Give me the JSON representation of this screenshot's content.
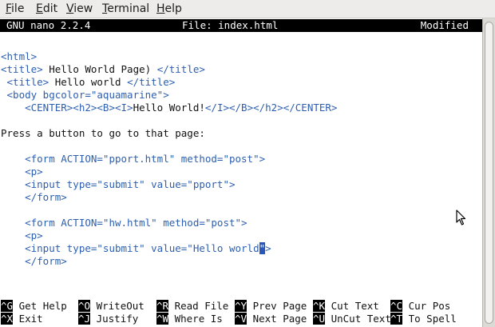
{
  "menubar": {
    "items": [
      {
        "accel": "F",
        "rest": "ile"
      },
      {
        "accel": "E",
        "rest": "dit"
      },
      {
        "accel": "V",
        "rest": "iew"
      },
      {
        "accel": "T",
        "rest": "erminal"
      },
      {
        "accel": "H",
        "rest": "elp"
      }
    ]
  },
  "nano": {
    "version": "GNU nano 2.2.4",
    "file": "File: index.html",
    "status": "Modified"
  },
  "editor": {
    "lines": [
      {
        "parts": [
          {
            "t": "tag",
            "s": "<html>"
          }
        ]
      },
      {
        "parts": [
          {
            "t": "tag",
            "s": "<title>"
          },
          {
            "t": "txt",
            "s": " Hello World Page) "
          },
          {
            "t": "tag",
            "s": "</title>"
          }
        ]
      },
      {
        "parts": [
          {
            "t": "tag",
            "s": " <title>"
          },
          {
            "t": "txt",
            "s": " Hello world "
          },
          {
            "t": "tag",
            "s": "</title>"
          }
        ]
      },
      {
        "parts": [
          {
            "t": "tag",
            "s": " <body bgcolor=\"aquamarine\">"
          }
        ]
      },
      {
        "parts": [
          {
            "t": "tag",
            "s": "    <CENTER><h2><B><I>"
          },
          {
            "t": "txt",
            "s": "Hello World!"
          },
          {
            "t": "tag",
            "s": "</I></B></h2></CENTER>"
          }
        ]
      },
      {
        "parts": []
      },
      {
        "parts": [
          {
            "t": "txt",
            "s": "Press a button to go to that page:"
          }
        ]
      },
      {
        "parts": []
      },
      {
        "parts": [
          {
            "t": "tag",
            "s": "    <form ACTION=\"pport.html\" method=\"post\">"
          }
        ]
      },
      {
        "parts": [
          {
            "t": "tag",
            "s": "    <p>"
          }
        ]
      },
      {
        "parts": [
          {
            "t": "tag",
            "s": "    <input type=\"submit\" value=\"pport\">"
          }
        ]
      },
      {
        "parts": [
          {
            "t": "tag",
            "s": "    </form>"
          }
        ]
      },
      {
        "parts": []
      },
      {
        "parts": [
          {
            "t": "tag",
            "s": "    <form ACTION=\"hw.html\" method=\"post\">"
          }
        ]
      },
      {
        "parts": [
          {
            "t": "tag",
            "s": "    <p>"
          }
        ]
      },
      {
        "parts": [
          {
            "t": "tag",
            "s": "    <input type=\"submit\" value=\"Hello world"
          },
          {
            "t": "cursor",
            "s": "\""
          },
          {
            "t": "tag",
            "s": ">"
          }
        ]
      },
      {
        "parts": [
          {
            "t": "tag",
            "s": "    </form>"
          }
        ]
      }
    ]
  },
  "shortcuts": [
    [
      {
        "key": "^G",
        "label": " Get Help"
      },
      {
        "key": "^O",
        "label": " WriteOut"
      },
      {
        "key": "^R",
        "label": " Read File"
      },
      {
        "key": "^Y",
        "label": " Prev Page"
      },
      {
        "key": "^K",
        "label": " Cut Text"
      },
      {
        "key": "^C",
        "label": " Cur Pos"
      }
    ],
    [
      {
        "key": "^X",
        "label": " Exit"
      },
      {
        "key": "^J",
        "label": " Justify"
      },
      {
        "key": "^W",
        "label": " Where Is"
      },
      {
        "key": "^V",
        "label": " Next Page"
      },
      {
        "key": "^U",
        "label": " UnCut Text"
      },
      {
        "key": "^T",
        "label": " To Spell"
      }
    ]
  ]
}
